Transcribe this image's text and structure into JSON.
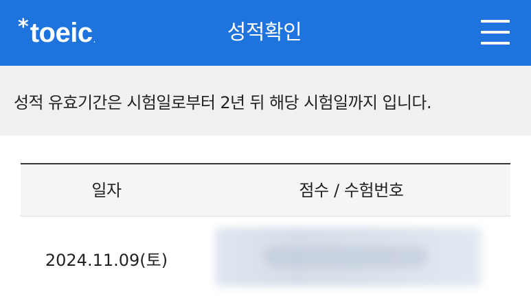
{
  "header": {
    "logo_star": "*",
    "logo_text": "toeic",
    "logo_dot": ".",
    "title": "성적확인",
    "accent_color": "#1e73dc",
    "menu_icon": "hamburger-menu-icon"
  },
  "notice": {
    "text": "성적 유효기간은 시험일로부터 2년 뒤 해당 시험일까지 입니다."
  },
  "table": {
    "headers": {
      "date": "일자",
      "score": "점수 / 수험번호"
    },
    "rows": [
      {
        "date": "2024.11.09(토)"
      }
    ]
  }
}
